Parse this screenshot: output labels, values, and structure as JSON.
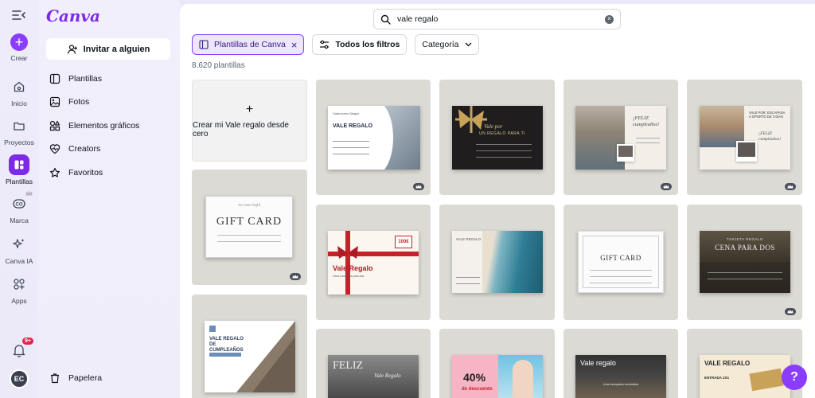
{
  "app": {
    "logo": "Canva"
  },
  "rail": {
    "create": "Crear",
    "items": [
      {
        "label": "Inicio"
      },
      {
        "label": "Proyectos"
      },
      {
        "label": "Plantillas"
      },
      {
        "label": "Marca"
      },
      {
        "label": "Canva IA"
      },
      {
        "label": "Apps"
      }
    ],
    "notifications_badge": "9+",
    "avatar_initials": "EC"
  },
  "panel": {
    "invite": "Invitar a alguien",
    "menu": [
      {
        "label": "Plantillas"
      },
      {
        "label": "Fotos"
      },
      {
        "label": "Elementos gráficos"
      },
      {
        "label": "Creators"
      },
      {
        "label": "Favoritos"
      }
    ],
    "trash": "Papelera"
  },
  "search": {
    "value": "vale regalo"
  },
  "filters": {
    "canva_templates": "Plantillas de Canva",
    "all_filters": "Todos los filtros",
    "category": "Categoría"
  },
  "results": {
    "count": "8.620 plantillas",
    "create_blank": "Crear mi Vale regalo desde cero"
  },
  "templates": {
    "t1": {
      "title": "VALE REGALO",
      "sub": "Gastronomía Sangue"
    },
    "t2": {
      "title": "Vale por",
      "sub": "UN REGALO PARA TI"
    },
    "t3": {
      "title": "¡FELIZ cumpleaños!"
    },
    "t4": {
      "title": "VALE POR: ESCAPADA A OPORTO DE 3 DÍAS",
      "sub": "¡FELIZ cumpleaños!"
    },
    "t5": {
      "title": "GIFT CARD",
      "sub": "TU LOGO AQUÍ"
    },
    "t6": {
      "title": "Vale Regalo",
      "sub": "Cena romántica para dos",
      "price": "100€"
    },
    "t7": {
      "title": "VALE REGALO"
    },
    "t8": {
      "title": "GIFT CARD"
    },
    "t9": {
      "title": "TARJETA REGALO",
      "sub": "CENA PARA DOS"
    },
    "t10": {
      "title": "VALE REGALO DE CUMPLEAÑOS"
    },
    "t11": {
      "title": "FELIZ",
      "sub": "Vale Regalo"
    },
    "t12": {
      "title": "40%",
      "sub": "de descuento"
    },
    "t13": {
      "title": "Vale regalo",
      "sub": "Una escapada romántica"
    },
    "t14": {
      "title": "VALE REGALO",
      "sub": "ENTRADA 2X1"
    }
  },
  "help": "?"
}
